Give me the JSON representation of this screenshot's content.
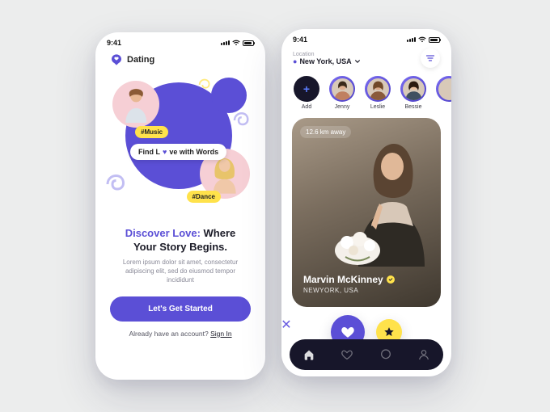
{
  "status": {
    "time": "9:41"
  },
  "brand": {
    "name": "Dating"
  },
  "hero": {
    "tag_music": "#Music",
    "tag_dance": "#Dance",
    "tagline_a": "Find L",
    "tagline_b": "ve with Words"
  },
  "headline": {
    "accent": "Discover Love:",
    "rest": " Where",
    "line2": "Your Story Begins."
  },
  "lorem": "Lorem ipsum dolor sit amet, consectetur adipiscing elit, sed do eiusmod tempor incididunt",
  "cta": {
    "label": "Let's Get Started"
  },
  "signin": {
    "prompt": "Already have an account? ",
    "link": "Sign In"
  },
  "location": {
    "label": "Location",
    "value": "New York, USA"
  },
  "stories": [
    {
      "name": "Add",
      "add": true
    },
    {
      "name": "Jenny"
    },
    {
      "name": "Leslie"
    },
    {
      "name": "Bessie"
    }
  ],
  "card": {
    "distance": "12.6 km away",
    "name": "Marvin McKinney",
    "city": "NEWYORK, USA"
  },
  "colors": {
    "primary": "#5b4fd6",
    "accent": "#ffe24b"
  }
}
